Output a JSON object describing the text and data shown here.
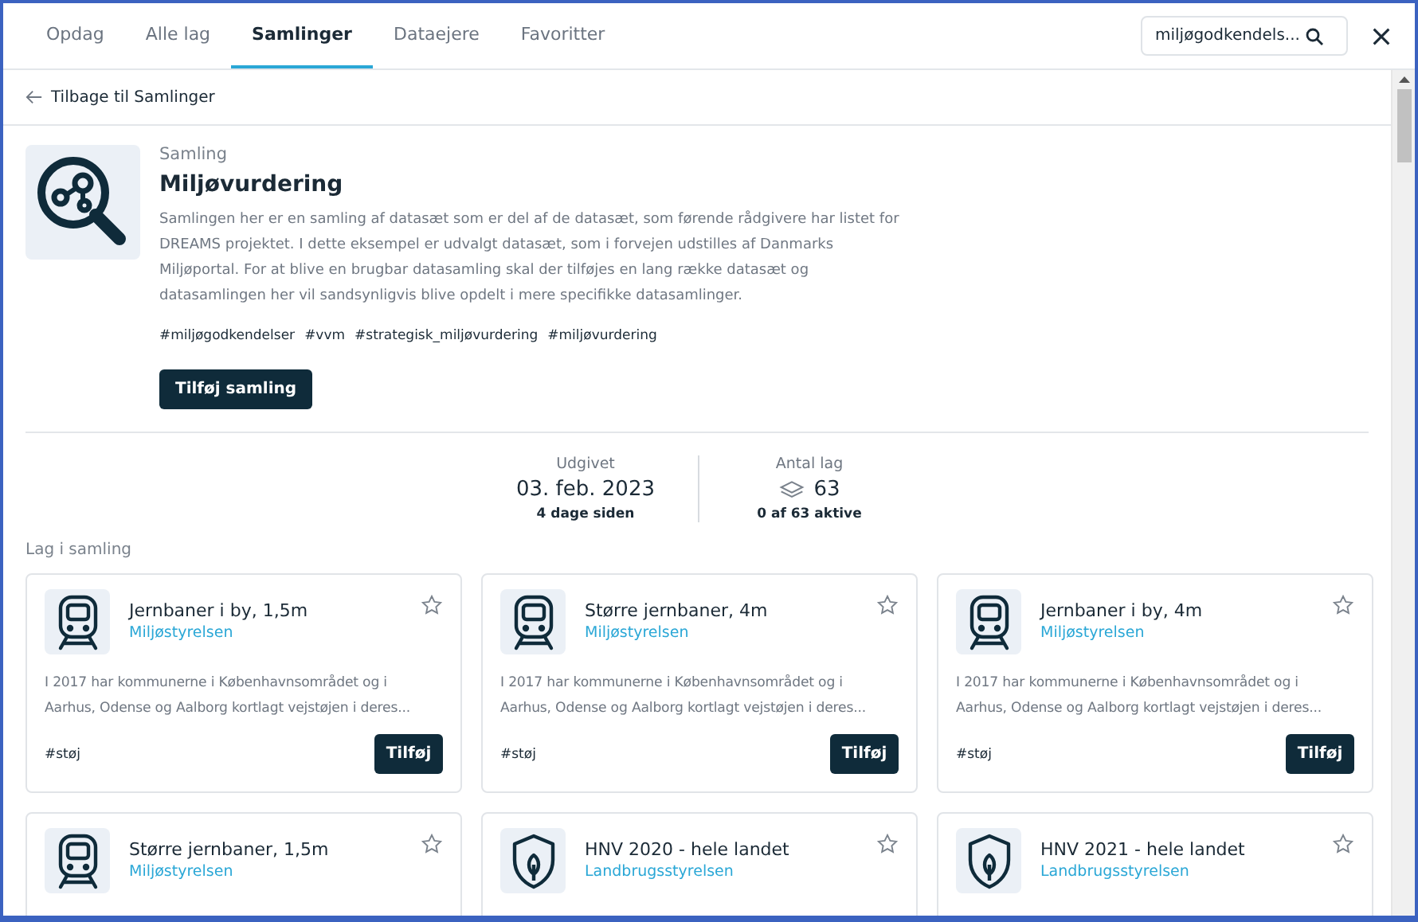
{
  "tabs": [
    {
      "label": "Opdag",
      "selected": false
    },
    {
      "label": "Alle lag",
      "selected": false
    },
    {
      "label": "Samlinger",
      "selected": true
    },
    {
      "label": "Dataejere",
      "selected": false
    },
    {
      "label": "Favoritter",
      "selected": false
    }
  ],
  "search": {
    "value": "miljøgodkendels..."
  },
  "back_link": "Tilbage til Samlinger",
  "collection": {
    "eyebrow": "Samling",
    "title": "Miljøvurdering",
    "description": "Samlingen her er en samling af datasæt som er del af de datasæt, som førende rådgivere har listet for DREAMS projektet. I dette eksempel er udvalgt datasæt, som i forvejen udstilles af Danmarks Miljøportal. For at blive en brugbar datasamling skal der tilføjes en lang række datasæt og datasamlingen her vil sandsynligvis blive opdelt i mere specifikke datasamlinger.",
    "tags": [
      "#miljøgodkendelser",
      "#vvm",
      "#strategisk_miljøvurdering",
      "#miljøvurdering"
    ],
    "button": "Tilføj samling"
  },
  "stats": [
    {
      "label": "Udgivet",
      "value": "03. feb. 2023",
      "sub": "4 dage siden",
      "kind": "date"
    },
    {
      "label": "Antal lag",
      "value": "63",
      "sub": "0 af 63 aktive",
      "kind": "layers"
    }
  ],
  "section_title": "Lag i samling",
  "layers": [
    {
      "kind": "train",
      "title": "Jernbaner i by, 1,5m",
      "owner": "Miljøstyrelsen",
      "description": "I 2017 har kommunerne i Københavnsområdet og i Aarhus, Odense og Aalborg kortlagt vejstøjen i deres...",
      "tag": "#støj",
      "button": "Tilføj",
      "favorite": false
    },
    {
      "kind": "train",
      "title": "Større jernbaner, 4m",
      "owner": "Miljøstyrelsen",
      "description": "I 2017 har kommunerne i Københavnsområdet og i Aarhus, Odense og Aalborg kortlagt vejstøjen i deres...",
      "tag": "#støj",
      "button": "Tilføj",
      "favorite": false
    },
    {
      "kind": "train",
      "title": "Jernbaner i by, 4m",
      "owner": "Miljøstyrelsen",
      "description": "I 2017 har kommunerne i Københavnsområdet og i Aarhus, Odense og Aalborg kortlagt vejstøjen i deres...",
      "tag": "#støj",
      "button": "Tilføj",
      "favorite": false
    },
    {
      "kind": "train",
      "title": "Større jernbaner, 1,5m",
      "owner": "Miljøstyrelsen",
      "favorite": false
    },
    {
      "kind": "nature",
      "title": "HNV 2020 - hele landet",
      "owner": "Landbrugsstyrelsen",
      "favorite": false
    },
    {
      "kind": "nature",
      "title": "HNV 2021 - hele landet",
      "owner": "Landbrugsstyrelsen",
      "favorite": false
    }
  ]
}
